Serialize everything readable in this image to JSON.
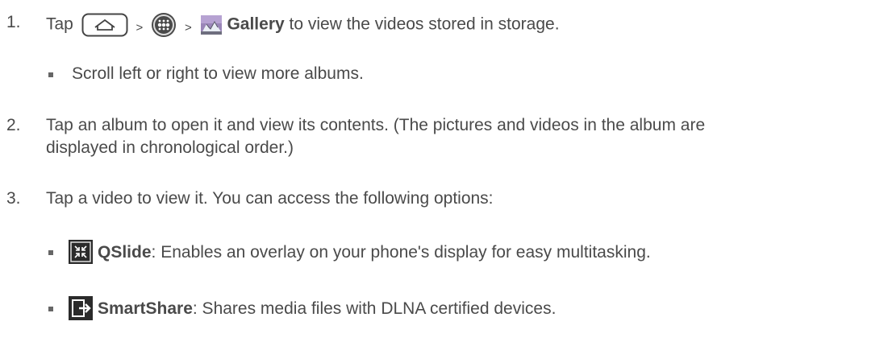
{
  "steps": [
    {
      "number": "1.",
      "pre": "Tap",
      "gt1": ">",
      "gt2": ">",
      "bold": "Gallery",
      "post": " to view the videos stored in storage.",
      "bullets": [
        "Scroll left or right to view more albums."
      ]
    },
    {
      "number": "2.",
      "line1": "Tap an album to open it and view its contents. (The pictures and videos in the album are",
      "line2": "displayed in chronological order.)"
    },
    {
      "number": "3.",
      "text": "Tap a video to view it. You can access the following options:",
      "options": [
        {
          "icon": "qslide-icon",
          "label": "QSlide",
          "desc": ": Enables an overlay on your phone's display for easy multitasking."
        },
        {
          "icon": "smartshare-icon",
          "label": "SmartShare",
          "desc": ": Shares media files with DLNA certified devices."
        }
      ]
    }
  ]
}
